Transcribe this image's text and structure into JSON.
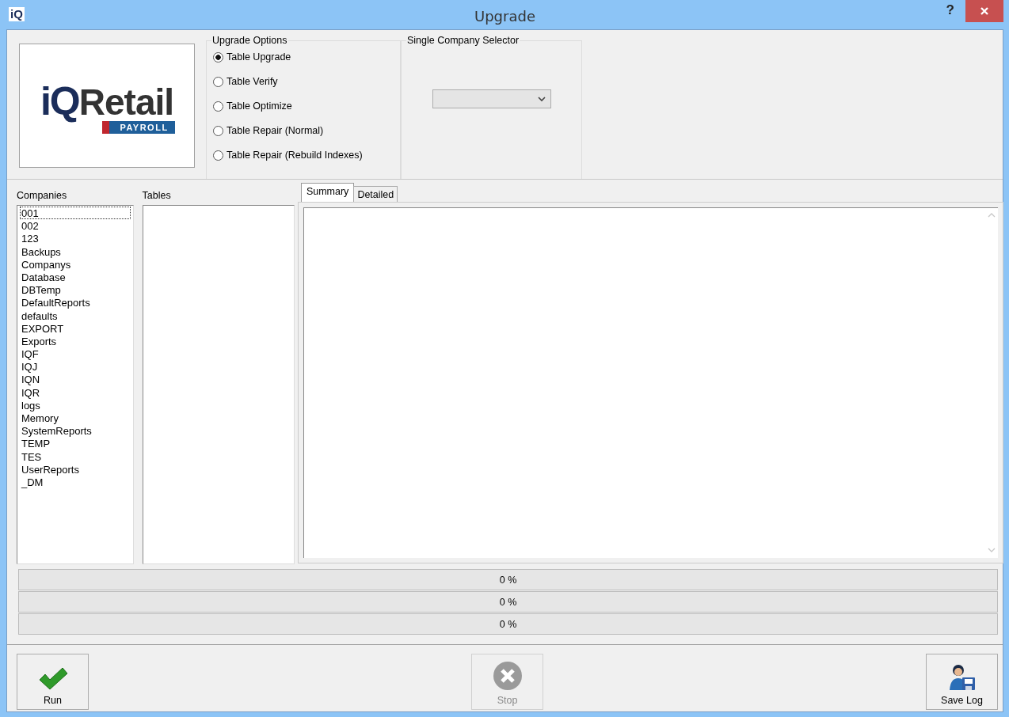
{
  "window": {
    "title": "Upgrade",
    "icon_text": "iQ",
    "help": "?"
  },
  "logo": {
    "brand_mark": "iQ",
    "brand_name": "Retail",
    "tagline": "PAYROLL"
  },
  "upgrade_options": {
    "title": "Upgrade Options",
    "options": [
      {
        "label": "Table Upgrade",
        "selected": true
      },
      {
        "label": "Table Verify",
        "selected": false
      },
      {
        "label": "Table Optimize",
        "selected": false
      },
      {
        "label": "Table Repair (Normal)",
        "selected": false
      },
      {
        "label": "Table Repair (Rebuild Indexes)",
        "selected": false
      }
    ]
  },
  "company_selector": {
    "title": "Single Company Selector"
  },
  "companies": {
    "label": "Companies",
    "items": [
      {
        "label": "001",
        "focused": true
      },
      {
        "label": "002",
        "focused": false
      },
      {
        "label": "123",
        "focused": false
      },
      {
        "label": "Backups",
        "focused": false
      },
      {
        "label": "Companys",
        "focused": false
      },
      {
        "label": "Database",
        "focused": false
      },
      {
        "label": "DBTemp",
        "focused": false
      },
      {
        "label": "DefaultReports",
        "focused": false
      },
      {
        "label": "defaults",
        "focused": false
      },
      {
        "label": "EXPORT",
        "focused": false
      },
      {
        "label": "Exports",
        "focused": false
      },
      {
        "label": "IQF",
        "focused": false
      },
      {
        "label": "IQJ",
        "focused": false
      },
      {
        "label": "IQN",
        "focused": false
      },
      {
        "label": "IQR",
        "focused": false
      },
      {
        "label": "logs",
        "focused": false
      },
      {
        "label": "Memory",
        "focused": false
      },
      {
        "label": "SystemReports",
        "focused": false
      },
      {
        "label": "TEMP",
        "focused": false
      },
      {
        "label": "TES",
        "focused": false
      },
      {
        "label": "UserReports",
        "focused": false
      },
      {
        "label": "_DM",
        "focused": false
      }
    ]
  },
  "tables": {
    "label": "Tables"
  },
  "tabs": [
    {
      "label": "Summary",
      "selected": true
    },
    {
      "label": "Detailed",
      "selected": false
    }
  ],
  "progress": [
    {
      "level": 0,
      "reading": "0 %"
    },
    {
      "level": 0,
      "reading": "0 %"
    },
    {
      "level": 0,
      "reading": "0 %"
    }
  ],
  "buttons": [
    {
      "kind": "run",
      "label": "Run",
      "disabled": false
    },
    {
      "kind": "stop",
      "label": "Stop",
      "disabled": true
    },
    {
      "kind": "save",
      "label": "Save Log",
      "disabled": false
    }
  ]
}
